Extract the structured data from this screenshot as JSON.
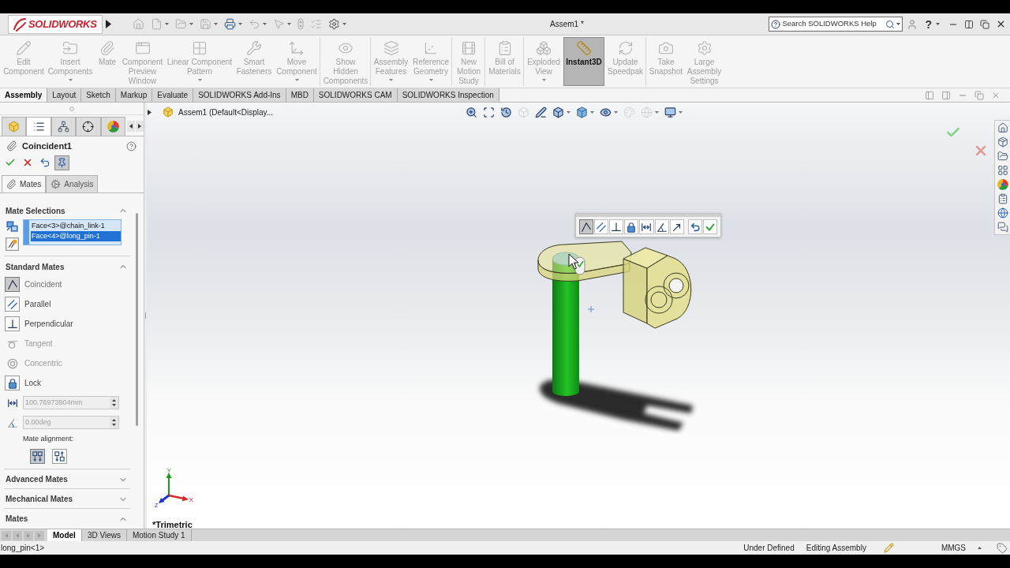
{
  "title_bar": {
    "logo_text": "SOLIDWORKS",
    "quick_access": [
      {
        "kind": "home",
        "disabled": true,
        "dropdown": false
      },
      {
        "kind": "new",
        "disabled": true,
        "dropdown": true
      },
      {
        "kind": "open",
        "disabled": true,
        "dropdown": true
      },
      {
        "kind": "save",
        "disabled": true,
        "dropdown": true
      },
      {
        "kind": "print",
        "disabled": false,
        "dropdown": true
      },
      {
        "kind": "undo",
        "disabled": true,
        "dropdown": true
      },
      {
        "kind": "select",
        "disabled": true,
        "dropdown": true
      },
      {
        "kind": "rebuild",
        "disabled": true,
        "dropdown": false
      },
      {
        "kind": "properties",
        "disabled": true,
        "dropdown": false
      },
      {
        "kind": "options",
        "disabled": false,
        "dropdown": true
      }
    ],
    "title": "Assem1 *",
    "search": {
      "placeholder": "Search SOLIDWORKS Help"
    },
    "help_label": "?"
  },
  "ribbon": {
    "groups": [
      {
        "buttons": [
          {
            "kind": "edit",
            "label": "Edit Component",
            "disabled": true,
            "selected": false,
            "dropdown": false
          },
          {
            "kind": "insert",
            "label": "Insert Components",
            "disabled": true,
            "selected": false,
            "dropdown": true
          },
          {
            "kind": "mate",
            "label": "Mate",
            "disabled": true,
            "selected": false,
            "dropdown": false
          },
          {
            "kind": "preview",
            "label": "Component Preview Window",
            "disabled": true,
            "selected": false,
            "dropdown": false
          },
          {
            "kind": "pattern",
            "label": "Linear Component Pattern",
            "disabled": true,
            "selected": false,
            "dropdown": true
          },
          {
            "kind": "fasteners",
            "label": "Smart Fasteners",
            "disabled": true,
            "selected": false,
            "dropdown": false
          },
          {
            "kind": "move",
            "label": "Move Component",
            "disabled": true,
            "selected": false,
            "dropdown": true
          }
        ]
      },
      {
        "buttons": [
          {
            "kind": "show",
            "label": "Show Hidden Components",
            "disabled": true,
            "selected": false,
            "dropdown": false
          }
        ]
      },
      {
        "buttons": [
          {
            "kind": "features",
            "label": "Assembly Features",
            "disabled": true,
            "selected": false,
            "dropdown": true
          },
          {
            "kind": "reference",
            "label": "Reference Geometry",
            "disabled": true,
            "selected": false,
            "dropdown": true
          }
        ]
      },
      {
        "buttons": [
          {
            "kind": "motion",
            "label": "New Motion Study",
            "disabled": true,
            "selected": false,
            "dropdown": false
          }
        ]
      },
      {
        "buttons": [
          {
            "kind": "bom",
            "label": "Bill of Materials",
            "disabled": true,
            "selected": false,
            "dropdown": false
          }
        ]
      },
      {
        "buttons": [
          {
            "kind": "explode",
            "label": "Exploded View",
            "disabled": true,
            "selected": false,
            "dropdown": true
          },
          {
            "kind": "instant3d",
            "label": "Instant3D",
            "disabled": false,
            "selected": true,
            "dropdown": false
          },
          {
            "kind": "speedpak",
            "label": "Update Speedpak",
            "disabled": true,
            "selected": false,
            "dropdown": false
          }
        ]
      },
      {
        "buttons": [
          {
            "kind": "snapshot",
            "label": "Take Snapshot",
            "disabled": true,
            "selected": false,
            "dropdown": false
          },
          {
            "kind": "large",
            "label": "Large Assembly Settings",
            "disabled": true,
            "selected": false,
            "dropdown": false
          }
        ]
      }
    ]
  },
  "command_tabs": [
    {
      "label": "Assembly",
      "selected": true
    },
    {
      "label": "Layout",
      "selected": false
    },
    {
      "label": "Sketch",
      "selected": false
    },
    {
      "label": "Markup",
      "selected": false
    },
    {
      "label": "Evaluate",
      "selected": false
    },
    {
      "label": "SOLIDWORKS Add-Ins",
      "selected": false
    },
    {
      "label": "MBD",
      "selected": false
    },
    {
      "label": "SOLIDWORKS CAM",
      "selected": false
    },
    {
      "label": "SOLIDWORKS Inspection",
      "selected": false
    }
  ],
  "property_manager": {
    "manager_tabs": [
      {
        "kind": "feature",
        "selected": false
      },
      {
        "kind": "property",
        "selected": true
      },
      {
        "kind": "configuration",
        "selected": false
      },
      {
        "kind": "dimxpert",
        "selected": false
      },
      {
        "kind": "display",
        "selected": false
      }
    ],
    "title": "Coincident1",
    "actions": [
      {
        "kind": "ok",
        "pressed": false
      },
      {
        "kind": "cancel",
        "pressed": false
      },
      {
        "kind": "undo",
        "pressed": false
      },
      {
        "kind": "pin",
        "pressed": true
      }
    ],
    "sub_tabs": [
      {
        "kind": "mates",
        "label": "Mates",
        "selected": true
      },
      {
        "kind": "analysis",
        "label": "Analysis",
        "selected": false
      }
    ],
    "sections": [
      {
        "kind": "selections",
        "title": "Mate Selections",
        "expanded": true,
        "items": [
          {
            "label": "Face<3>@chain_link-1",
            "selected": false
          },
          {
            "label": "Face<4>@long_pin-1",
            "selected": true
          }
        ]
      },
      {
        "kind": "standard",
        "title": "Standard Mates",
        "expanded": true,
        "mates": [
          {
            "kind": "coincident",
            "label": "Coincident",
            "selected": true,
            "disabled": false
          },
          {
            "kind": "parallel",
            "label": "Parallel",
            "selected": false,
            "disabled": false
          },
          {
            "kind": "perpendicular",
            "label": "Perpendicular",
            "selected": false,
            "disabled": false
          },
          {
            "kind": "tangent",
            "label": "Tangent",
            "selected": false,
            "disabled": true
          },
          {
            "kind": "concentric",
            "label": "Concentric",
            "selected": false,
            "disabled": true
          },
          {
            "kind": "lock",
            "label": "Lock",
            "selected": false,
            "disabled": false
          },
          {
            "kind": "distance",
            "value": "100.76973904mm",
            "selected": false,
            "disabled": true
          },
          {
            "kind": "angle",
            "value": "0.00deg",
            "selected": false,
            "disabled": true
          }
        ],
        "alignment": {
          "label": "Mate alignment:",
          "options": [
            {
              "kind": "aligned",
              "selected": true
            },
            {
              "kind": "anti",
              "selected": false
            }
          ]
        }
      },
      {
        "kind": "plain",
        "title": "Advanced Mates",
        "expanded": false
      },
      {
        "kind": "plain",
        "title": "Mechanical Mates",
        "expanded": false
      },
      {
        "kind": "plain",
        "title": "Mates",
        "expanded": true
      }
    ]
  },
  "viewport": {
    "breadcrumb": "Assem1 (Default<Display...",
    "view_toolbar": [
      {
        "kind": "zoom-fit",
        "disabled": false,
        "dropdown": false
      },
      {
        "kind": "zoom-area",
        "disabled": false,
        "dropdown": false
      },
      {
        "kind": "previous",
        "disabled": false,
        "dropdown": false
      },
      {
        "kind": "section",
        "disabled": true,
        "dropdown": false
      },
      {
        "kind": "dynamic",
        "disabled": false,
        "dropdown": false
      },
      {
        "kind": "orientation",
        "disabled": false,
        "dropdown": true
      },
      {
        "kind": "display",
        "disabled": false,
        "dropdown": true
      },
      {
        "kind": "hide",
        "disabled": false,
        "dropdown": true
      },
      {
        "kind": "appearance",
        "disabled": true,
        "dropdown": false
      },
      {
        "kind": "scene",
        "disabled": true,
        "dropdown": true
      },
      {
        "kind": "settings",
        "disabled": false,
        "dropdown": true
      }
    ],
    "mate_popup": [
      {
        "kind": "coincident",
        "selected": true
      },
      {
        "kind": "parallel",
        "selected": false
      },
      {
        "kind": "perpendicular",
        "selected": false
      },
      {
        "kind": "lock",
        "selected": false
      },
      {
        "kind": "distance",
        "selected": false
      },
      {
        "kind": "angle",
        "selected": false
      },
      {
        "kind": "flip",
        "selected": false
      },
      {
        "kind": "undo",
        "selected": false
      },
      {
        "kind": "ok",
        "selected": false
      }
    ],
    "triad": {
      "x": "X",
      "y": "Y",
      "z": "Z"
    },
    "view_label": "*Trimetric",
    "task_pane": [
      {
        "kind": "home"
      },
      {
        "kind": "library"
      },
      {
        "kind": "explorer"
      },
      {
        "kind": "palette"
      },
      {
        "kind": "appearances"
      },
      {
        "kind": "properties"
      },
      {
        "kind": "resources"
      },
      {
        "kind": "forum"
      }
    ]
  },
  "bottom_tabs": [
    {
      "label": "Model",
      "selected": true
    },
    {
      "label": "3D Views",
      "selected": false
    },
    {
      "label": "Motion Study 1",
      "selected": false
    }
  ],
  "status_bar": {
    "selection": "long_pin<1>",
    "state": "Under Defined",
    "mode": "Editing Assembly",
    "units": "MMGS"
  }
}
